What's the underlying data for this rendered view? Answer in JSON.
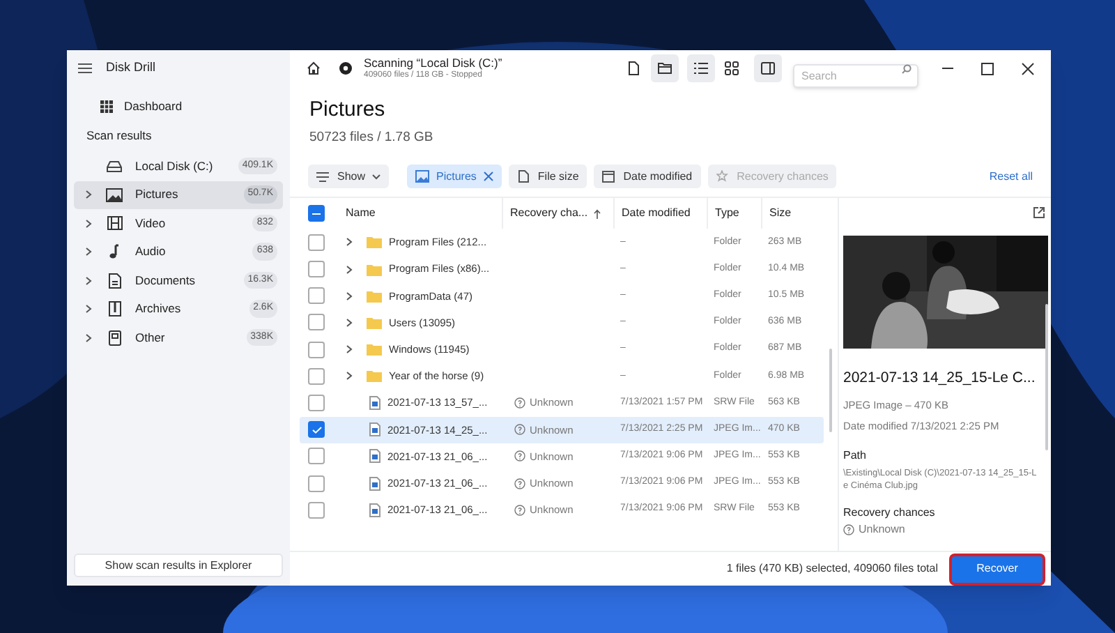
{
  "window": {
    "title": "Disk Drill"
  },
  "sidebar": {
    "dashboard": "Dashboard",
    "section": "Scan results",
    "items": [
      {
        "label": "Local Disk (C:)",
        "count": "409.1K",
        "kind": "disk",
        "expandable": false,
        "selected": false
      },
      {
        "label": "Pictures",
        "count": "50.7K",
        "kind": "pictures",
        "expandable": true,
        "selected": true
      },
      {
        "label": "Video",
        "count": "832",
        "kind": "video",
        "expandable": true,
        "selected": false
      },
      {
        "label": "Audio",
        "count": "638",
        "kind": "audio",
        "expandable": true,
        "selected": false
      },
      {
        "label": "Documents",
        "count": "16.3K",
        "kind": "documents",
        "expandable": true,
        "selected": false
      },
      {
        "label": "Archives",
        "count": "2.6K",
        "kind": "archives",
        "expandable": true,
        "selected": false
      },
      {
        "label": "Other",
        "count": "338K",
        "kind": "other",
        "expandable": true,
        "selected": false
      }
    ],
    "explorer_button": "Show scan results in Explorer"
  },
  "header": {
    "scan_title": "Scanning “Local Disk (C:)”",
    "scan_subtitle": "409060 files / 118 GB - Stopped",
    "search_placeholder": "Search",
    "view_toggles": [
      {
        "kind": "file",
        "selected": false
      },
      {
        "kind": "folder",
        "selected": true
      },
      {
        "kind": "list",
        "selected": true
      },
      {
        "kind": "grid",
        "selected": false
      },
      {
        "kind": "panel",
        "selected": true
      }
    ]
  },
  "page": {
    "title": "Pictures",
    "subtitle": "50723 files / 1.78 GB"
  },
  "filters": [
    {
      "label": "Show",
      "kind": "dropdown",
      "disabled": false
    },
    {
      "label": "Pictures",
      "kind": "active",
      "disabled": false
    },
    {
      "label": "File size",
      "kind": "size",
      "disabled": false
    },
    {
      "label": "Date modified",
      "kind": "date",
      "disabled": false
    },
    {
      "label": "Recovery chances",
      "kind": "chances",
      "disabled": true
    }
  ],
  "reset": "Reset all",
  "table": {
    "select_all_indeterminate": true,
    "columns": [
      "Name",
      "Recovery cha...",
      "Date modified",
      "Type",
      "Size"
    ],
    "rows": [
      {
        "kind": "folder",
        "name": "Program Files (212...",
        "recovery": "",
        "date": "–",
        "type": "Folder",
        "size": "263 MB",
        "checked": false,
        "selected": false
      },
      {
        "kind": "folder",
        "name": "Program Files (x86)...",
        "recovery": "",
        "date": "–",
        "type": "Folder",
        "size": "10.4 MB",
        "checked": false,
        "selected": false
      },
      {
        "kind": "folder",
        "name": "ProgramData (47)",
        "recovery": "",
        "date": "–",
        "type": "Folder",
        "size": "10.5 MB",
        "checked": false,
        "selected": false
      },
      {
        "kind": "folder",
        "name": "Users (13095)",
        "recovery": "",
        "date": "–",
        "type": "Folder",
        "size": "636 MB",
        "checked": false,
        "selected": false
      },
      {
        "kind": "folder",
        "name": "Windows (11945)",
        "recovery": "",
        "date": "–",
        "type": "Folder",
        "size": "687 MB",
        "checked": false,
        "selected": false
      },
      {
        "kind": "folder",
        "name": "Year of the horse (9)",
        "recovery": "",
        "date": "–",
        "type": "Folder",
        "size": "6.98 MB",
        "checked": false,
        "selected": false
      },
      {
        "kind": "file",
        "name": "2021-07-13 13_57_...",
        "recovery": "Unknown",
        "date": "7/13/2021 1:57 PM",
        "type": "SRW File",
        "size": "563 KB",
        "checked": false,
        "selected": false
      },
      {
        "kind": "file",
        "name": "2021-07-13 14_25_...",
        "recovery": "Unknown",
        "date": "7/13/2021 2:25 PM",
        "type": "JPEG Im...",
        "size": "470 KB",
        "checked": true,
        "selected": true
      },
      {
        "kind": "file",
        "name": "2021-07-13 21_06_...",
        "recovery": "Unknown",
        "date": "7/13/2021 9:06 PM",
        "type": "JPEG Im...",
        "size": "553 KB",
        "checked": false,
        "selected": false
      },
      {
        "kind": "file",
        "name": "2021-07-13 21_06_...",
        "recovery": "Unknown",
        "date": "7/13/2021 9:06 PM",
        "type": "JPEG Im...",
        "size": "553 KB",
        "checked": false,
        "selected": false
      },
      {
        "kind": "file",
        "name": "2021-07-13 21_06_...",
        "recovery": "Unknown",
        "date": "7/13/2021 9:06 PM",
        "type": "SRW File",
        "size": "553 KB",
        "checked": false,
        "selected": false
      }
    ]
  },
  "preview": {
    "kind": "picture",
    "name": "2021-07-13 14_25_15-Le C...",
    "info": "JPEG Image – 470 KB",
    "date": "Date modified 7/13/2021 2:25 PM",
    "path_label": "Path",
    "path": "\\Existing\\Local Disk (C)\\2021-07-13 14_25_15-Le Cinéma Club.jpg",
    "chances_label": "Recovery chances",
    "chances": "Unknown"
  },
  "status": "1 files (470 KB) selected, 409060 files total",
  "recover": "Recover"
}
